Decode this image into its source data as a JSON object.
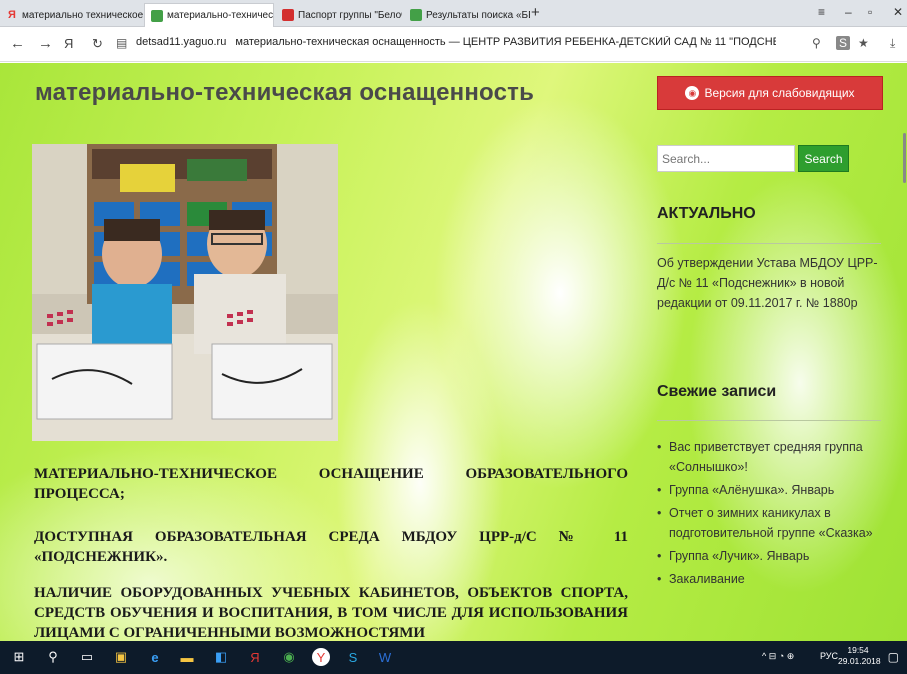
{
  "browser": {
    "tabs": [
      {
        "label": "материально техническое",
        "favicon": "yandex-icon",
        "color": "#e53935",
        "glyph": "Я",
        "active": false
      },
      {
        "label": "материально-техническ",
        "favicon": "site-icon",
        "color": "#43a047",
        "glyph": "▪",
        "active": true
      },
      {
        "label": "Паспорт группы \"Белочка\"",
        "favicon": "site-icon",
        "color": "#d32f2f",
        "glyph": "▪",
        "active": false
      },
      {
        "label": "Результаты поиска «БЕЛОЧ",
        "favicon": "site-icon",
        "color": "#43a047",
        "glyph": "▪",
        "active": false
      }
    ],
    "new_tab": "+",
    "close_tab": "×",
    "address": "detsad11.yaguo.ru",
    "page_title_in_bar": "материально-техническая оснащенность — ЦЕНТР РАЗВИТИЯ РЕБЕНКА-ДЕТСКИЙ САД № 11 \"ПОДСНЕ..."
  },
  "page": {
    "title": "материально-техническая оснащенность",
    "paragraphs": [
      "МАТЕРИАЛЬНО-ТЕХНИЧЕСКОЕ ОСНАЩЕНИЕ ОБРАЗОВАТЕЛЬНОГО ПРОЦЕССА;",
      "ДОСТУПНАЯ ОБРАЗОВАТЕЛЬНАЯ СРЕДА МБДОУ ЦРР-д/С № 11 «ПОДСНЕЖНИК».",
      "НАЛИЧИЕ ОБОРУДОВАННЫХ УЧЕБНЫХ КАБИНЕТОВ, ОБЪЕКТОВ СПОРТА, СРЕДСТВ ОБУЧЕНИЯ И ВОСПИТАНИЯ, В ТОМ ЧИСЛЕ ДЛЯ ИСПОЛЬЗОВАНИЯ ЛИЦАМИ С ОГРАНИЧЕННЫМИ ВОЗМОЖНОСТЯМИ"
    ]
  },
  "sidebar": {
    "vision_button": "Версия для слабовидящих",
    "search_placeholder": "Search...",
    "search_button": "Search",
    "actual_title": "АКТУАЛЬНО",
    "actual_text": "Об утверждении Устава МБДОУ ЦРР-Д/с № 11 «Подснежник» в новой редакции от 09.11.2017 г. № 1880р",
    "recent_title": "Свежие записи",
    "recent": [
      "Вас приветствует средняя группа «Солнышко»!",
      "Группа «Алёнушка». Январь",
      "Отчет о зимних каникулах в подготовительной группе «Сказка»",
      "Группа «Лучик». Январь",
      "Закаливание"
    ]
  },
  "taskbar": {
    "lang": "РУС",
    "time": "19:54",
    "date": "29.01.2018"
  },
  "colors": {
    "accent_red": "#d83a3a",
    "search_green": "#2e9e2e"
  }
}
